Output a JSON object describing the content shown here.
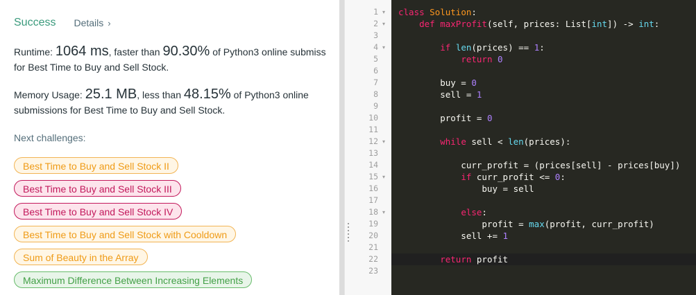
{
  "result": {
    "status": "Success",
    "details_link": "Details",
    "details_chevron": "›"
  },
  "runtime": {
    "prefix": "Runtime: ",
    "value": "1064 ms",
    "mid": ", faster than ",
    "percent": "90.30%",
    "suffix": " of Python3 online submiss",
    "line2": "for Best Time to Buy and Sell Stock."
  },
  "memory": {
    "prefix": "Memory Usage: ",
    "value": "25.1 MB",
    "mid": ", less than ",
    "percent": "48.15%",
    "suffix": " of Python3 online",
    "line2": "submissions for Best Time to Buy and Sell Stock."
  },
  "next": {
    "label": "Next challenges:",
    "challenges": [
      {
        "label": "Best Time to Buy and Sell Stock II",
        "difficulty": "medium"
      },
      {
        "label": "Best Time to Buy and Sell Stock III",
        "difficulty": "hard"
      },
      {
        "label": "Best Time to Buy and Sell Stock IV",
        "difficulty": "hard"
      },
      {
        "label": "Best Time to Buy and Sell Stock with Cooldown",
        "difficulty": "medium"
      },
      {
        "label": "Sum of Beauty in the Array",
        "difficulty": "medium"
      },
      {
        "label": "Maximum Difference Between Increasing Elements",
        "difficulty": "easy"
      }
    ]
  },
  "editor": {
    "theme_colors": {
      "background": "#272822",
      "keyword": "#f92672",
      "class_name": "#fd971f",
      "builtin": "#66d9ef",
      "number": "#ae81ff",
      "text": "#f8f8f2"
    },
    "active_line": 22,
    "fold_lines": [
      1,
      2,
      4,
      12,
      15,
      18
    ],
    "fold_marker": "▾",
    "lines": [
      [
        [
          "kw",
          "class"
        ],
        [
          "pl",
          " "
        ],
        [
          "cls",
          "Solution"
        ],
        [
          "pl",
          ":"
        ]
      ],
      [
        [
          "pl",
          "    "
        ],
        [
          "kw",
          "def"
        ],
        [
          "pl",
          " "
        ],
        [
          "fn",
          "maxProfit"
        ],
        [
          "pl",
          "(self, prices: List["
        ],
        [
          "bi",
          "int"
        ],
        [
          "pl",
          "]) -> "
        ],
        [
          "bi",
          "int"
        ],
        [
          "pl",
          ":"
        ]
      ],
      [],
      [
        [
          "pl",
          "        "
        ],
        [
          "kw",
          "if"
        ],
        [
          "pl",
          " "
        ],
        [
          "bi",
          "len"
        ],
        [
          "pl",
          "(prices) == "
        ],
        [
          "num",
          "1"
        ],
        [
          "pl",
          ":"
        ]
      ],
      [
        [
          "pl",
          "            "
        ],
        [
          "kw",
          "return"
        ],
        [
          "pl",
          " "
        ],
        [
          "num",
          "0"
        ]
      ],
      [],
      [
        [
          "pl",
          "        buy = "
        ],
        [
          "num",
          "0"
        ]
      ],
      [
        [
          "pl",
          "        sell = "
        ],
        [
          "num",
          "1"
        ]
      ],
      [],
      [
        [
          "pl",
          "        profit = "
        ],
        [
          "num",
          "0"
        ]
      ],
      [],
      [
        [
          "pl",
          "        "
        ],
        [
          "kw",
          "while"
        ],
        [
          "pl",
          " sell < "
        ],
        [
          "bi",
          "len"
        ],
        [
          "pl",
          "(prices):"
        ]
      ],
      [],
      [
        [
          "pl",
          "            curr_profit = (prices[sell] - prices[buy])"
        ]
      ],
      [
        [
          "pl",
          "            "
        ],
        [
          "kw",
          "if"
        ],
        [
          "pl",
          " curr_profit <= "
        ],
        [
          "num",
          "0"
        ],
        [
          "pl",
          ":"
        ]
      ],
      [
        [
          "pl",
          "                buy = sell"
        ]
      ],
      [],
      [
        [
          "pl",
          "            "
        ],
        [
          "kw",
          "else"
        ],
        [
          "pl",
          ":"
        ]
      ],
      [
        [
          "pl",
          "                profit = "
        ],
        [
          "bi",
          "max"
        ],
        [
          "pl",
          "(profit, curr_profit)"
        ]
      ],
      [
        [
          "pl",
          "            sell += "
        ],
        [
          "num",
          "1"
        ]
      ],
      [],
      [
        [
          "pl",
          "        "
        ],
        [
          "kw",
          "return"
        ],
        [
          "pl",
          " profit"
        ]
      ],
      []
    ]
  }
}
